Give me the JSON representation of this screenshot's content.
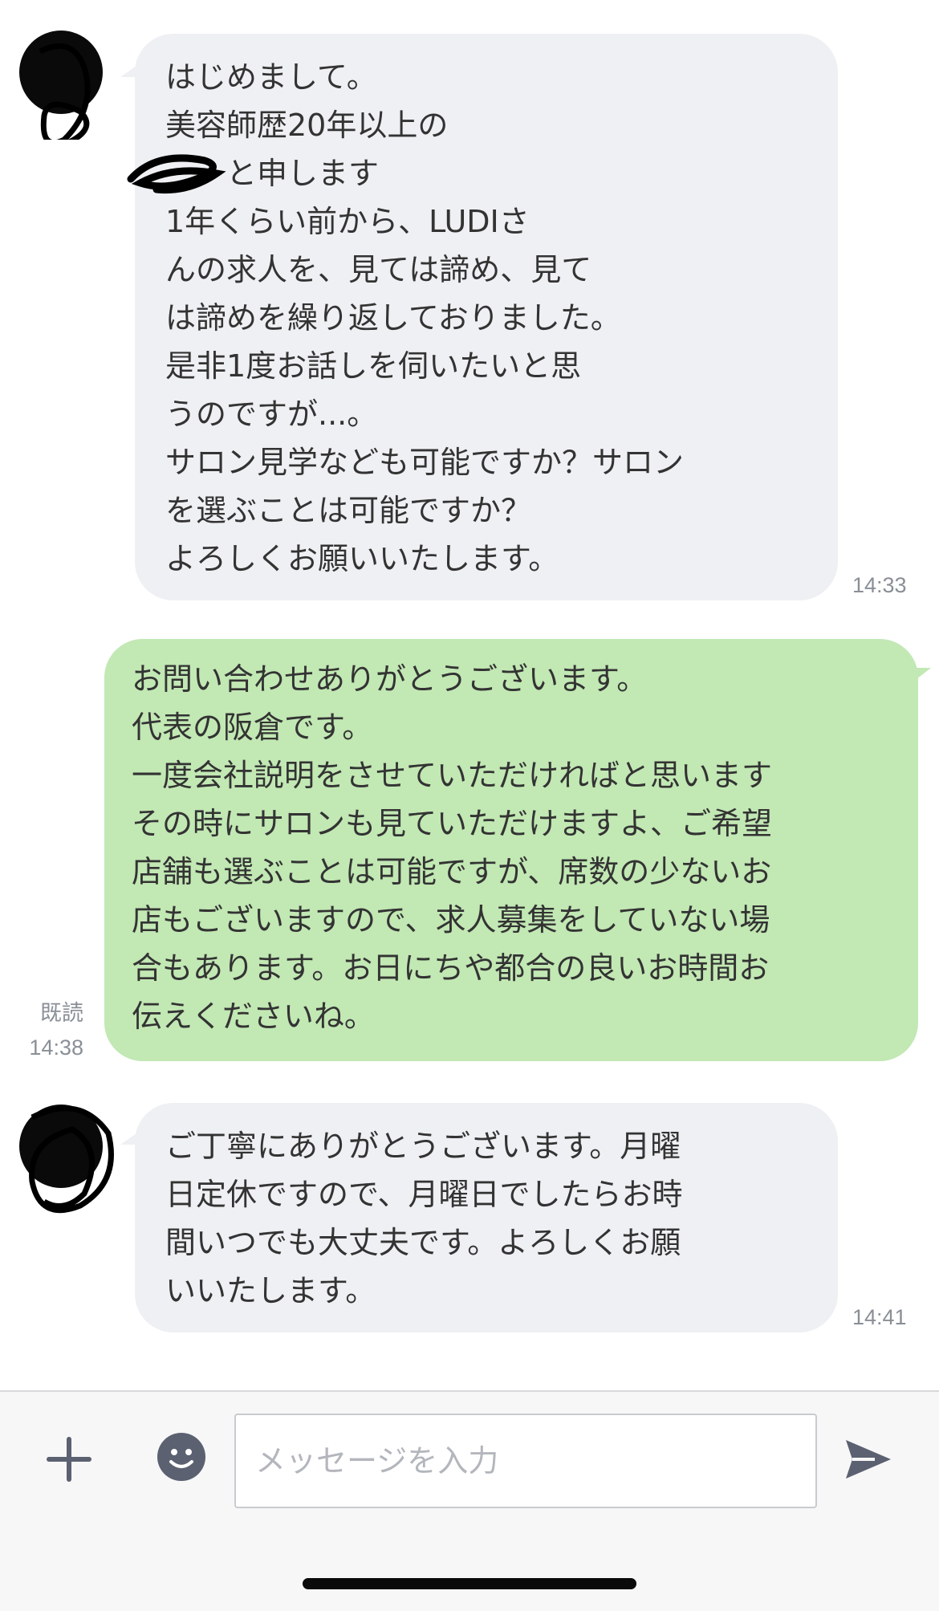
{
  "messages": [
    {
      "sender": "other",
      "lines": [
        "はじめまして。",
        "美容師歴20年以上の",
        "　　と申します",
        "1年くらい前から、LUDIさ",
        "んの求人を、見ては諦め、見て",
        "は諦めを繰り返しておりました。",
        "是非1度お話しを伺いたいと思",
        "うのですが...。",
        "サロン見学なども可能ですか？サロン",
        "を選ぶことは可能ですか？",
        "よろしくお願いいたします。"
      ],
      "time": "14:33"
    },
    {
      "sender": "me",
      "lines": [
        "お問い合わせありがとうございます。",
        "代表の阪倉です。",
        "一度会社説明をさせていただければと思います",
        "その時にサロンも見ていただけますよ、ご希望",
        "店舗も選ぶことは可能ですが、席数の少ないお",
        "店もございますので、求人募集をしていない場",
        "合もあります。お日にちや都合の良いお時間お",
        "伝えくださいね。"
      ],
      "read_label": "既読",
      "time": "14:38"
    },
    {
      "sender": "other",
      "lines": [
        "ご丁寧にありがとうございます。月曜",
        "日定休ですので、月曜日でしたらお時",
        "間いつでも大丈夫です。よろしくお願",
        "いいたします。"
      ],
      "time": "14:41"
    }
  ],
  "input": {
    "placeholder": "メッセージを入力"
  },
  "icons": {
    "plus": "plus-icon",
    "emoji": "emoji-icon",
    "send": "send-icon"
  },
  "colors": {
    "incoming_bubble": "#eff0f3",
    "outgoing_bubble": "#c2e8b4",
    "text": "#333333",
    "timestamp": "#8a8f96",
    "icon": "#5b6170"
  }
}
